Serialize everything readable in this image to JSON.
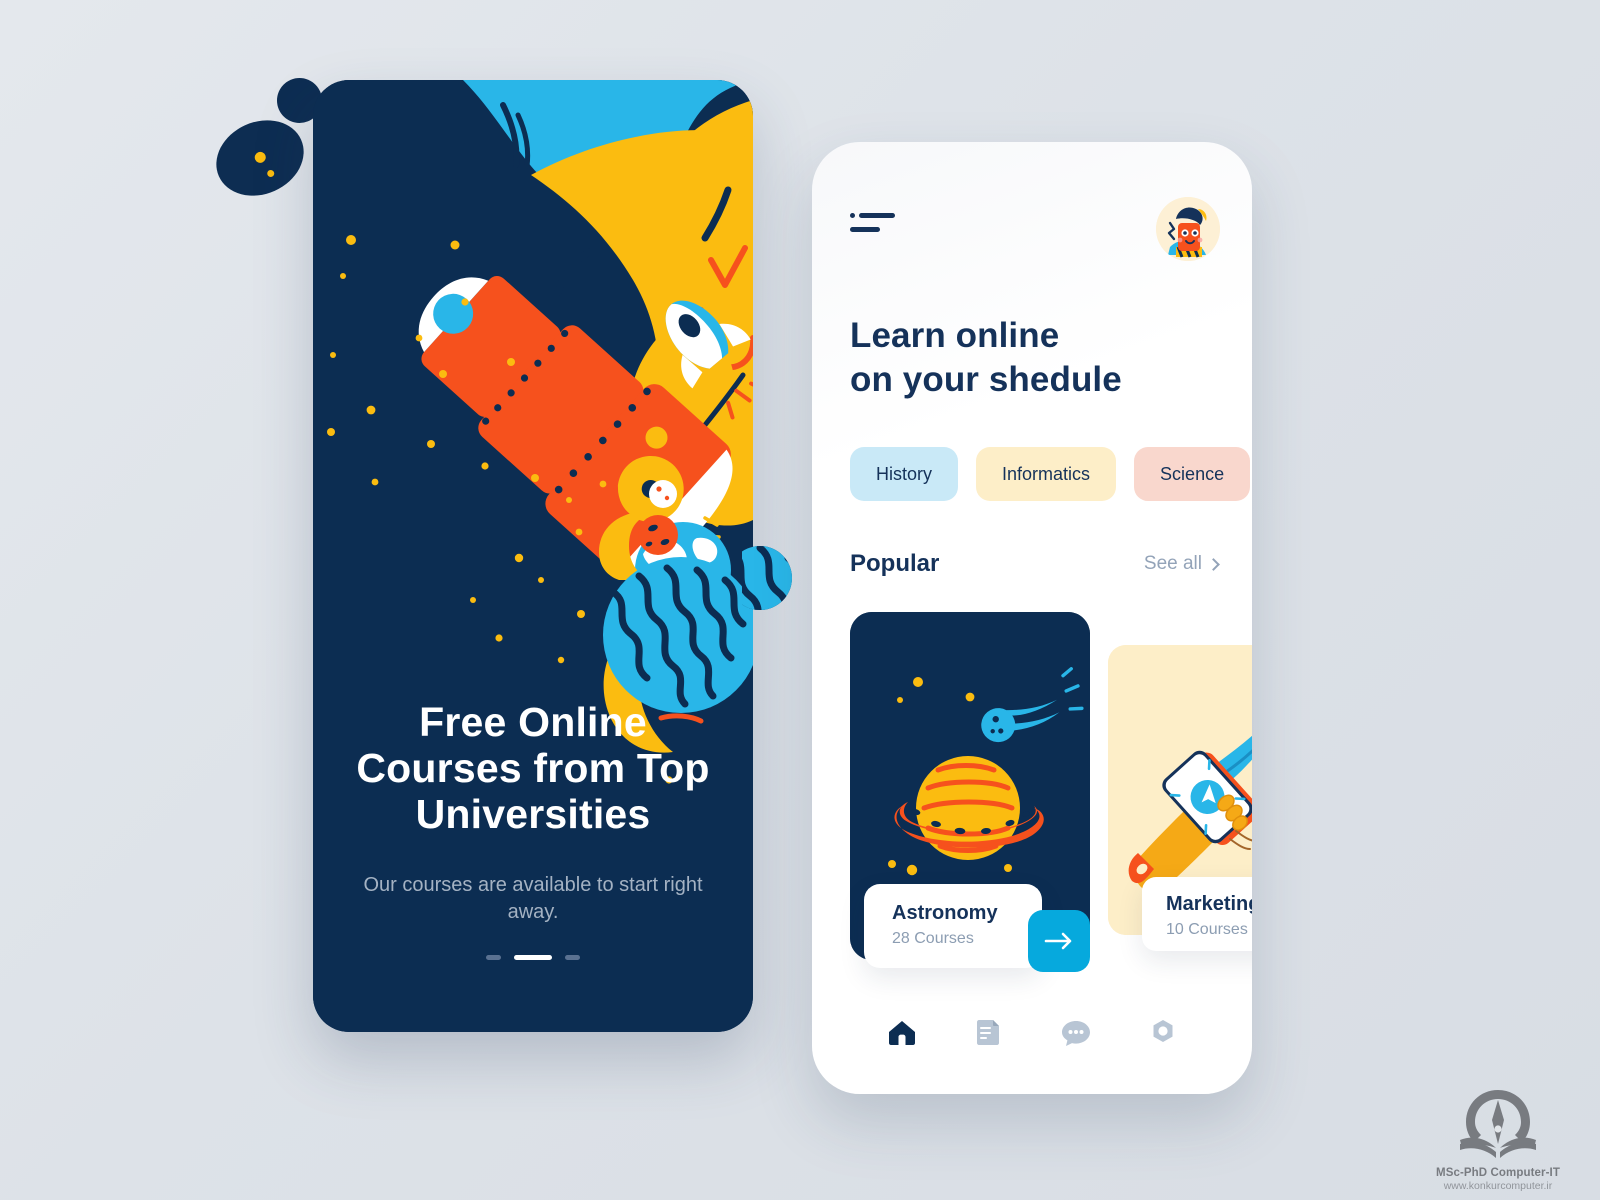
{
  "onboarding": {
    "title": "Free Online Courses from Top Universities",
    "subtitle": "Our courses are available to start right away.",
    "pager": {
      "total": 3,
      "active_index": 1
    }
  },
  "home": {
    "menu_icon": "hamburger-icon",
    "avatar_icon": "user-avatar",
    "headline_line1": "Learn online",
    "headline_line2": "on your shedule",
    "categories": [
      {
        "label": "History",
        "color": "#c9e9f7"
      },
      {
        "label": "Informatics",
        "color": "#fdeec8"
      },
      {
        "label": "Science",
        "color": "#f9d7cd"
      }
    ],
    "section": {
      "title": "Popular",
      "see_all": "See all",
      "see_all_icon": "chevron-right-icon"
    },
    "courses": [
      {
        "title": "Astronomy",
        "subtitle": "28 Courses",
        "art": "saturn-comet-illustration",
        "bg": "#0c2d52"
      },
      {
        "title": "Marketing",
        "subtitle": "10 Courses",
        "art": "hand-phone-paperplane-illustration",
        "bg": "#fdeec8"
      }
    ],
    "cta_icon": "arrow-right-icon",
    "nav": [
      {
        "icon": "home-icon",
        "active": true
      },
      {
        "icon": "document-icon",
        "active": false
      },
      {
        "icon": "chat-bubble-icon",
        "active": false
      },
      {
        "icon": "gear-icon",
        "active": false
      }
    ]
  },
  "watermark": {
    "name": "MSc-PhD Computer-IT",
    "url": "www.konkurcomputer.ir",
    "logo_icon": "pen-nib-book-logo"
  },
  "colors": {
    "navy": "#0c2d52",
    "navy_text": "#15325a",
    "cyan": "#06a9dd",
    "yellow": "#fbbc10",
    "orange": "#f6511d",
    "sky": "#29b6e8",
    "muted": "#8c9db2",
    "page_bg": "#dfe3e8"
  }
}
